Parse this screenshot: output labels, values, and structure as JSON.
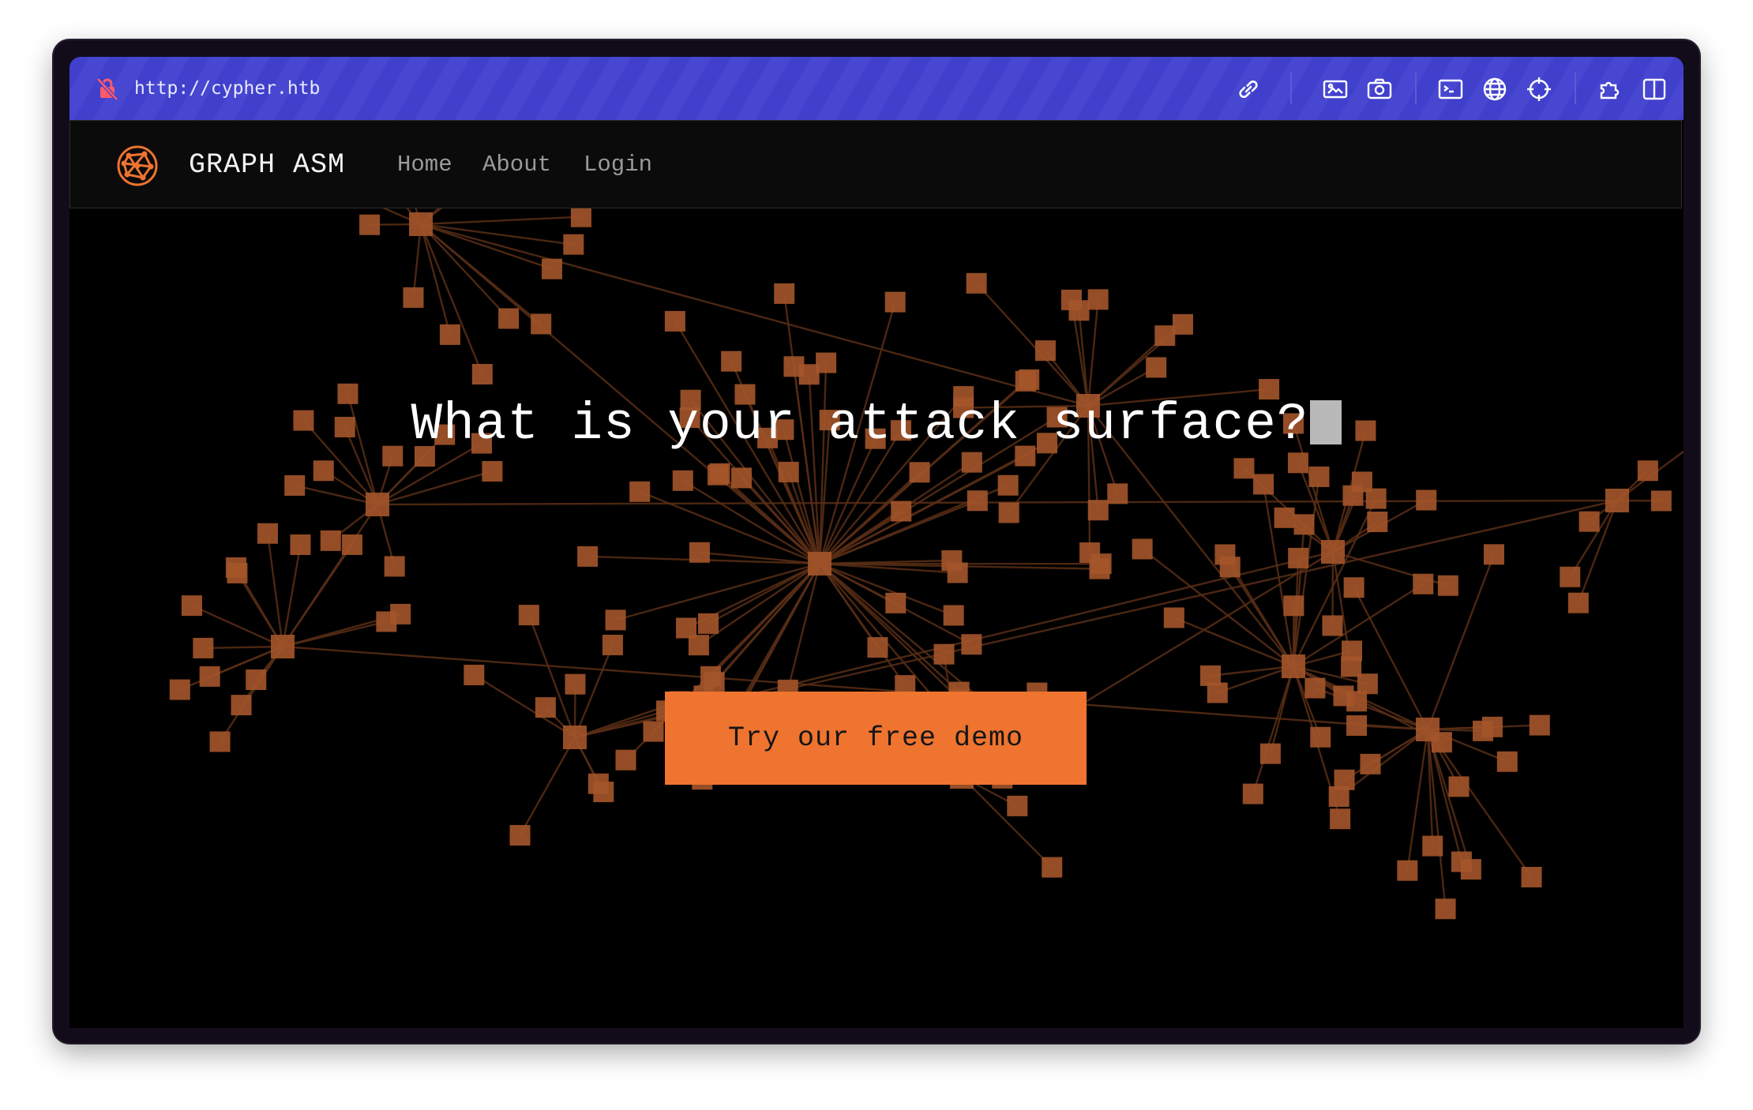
{
  "browser": {
    "url": "http://cypher.htb",
    "toolbar_icons": [
      "link-icon",
      "image-icon",
      "camera-icon",
      "terminal-icon",
      "globe-icon",
      "crosshair-icon",
      "extension-icon",
      "split-view-icon"
    ]
  },
  "nav": {
    "brand": "GRAPH ASM",
    "links": [
      "Home",
      "About",
      "Login"
    ]
  },
  "hero": {
    "title": "What is your attack surface?",
    "cta_label": "Try our free demo"
  },
  "colors": {
    "accent": "#ee7430",
    "node": "#a4552a",
    "edge": "#5a2e16",
    "address_bar": "#4040cc",
    "background": "#000000"
  }
}
